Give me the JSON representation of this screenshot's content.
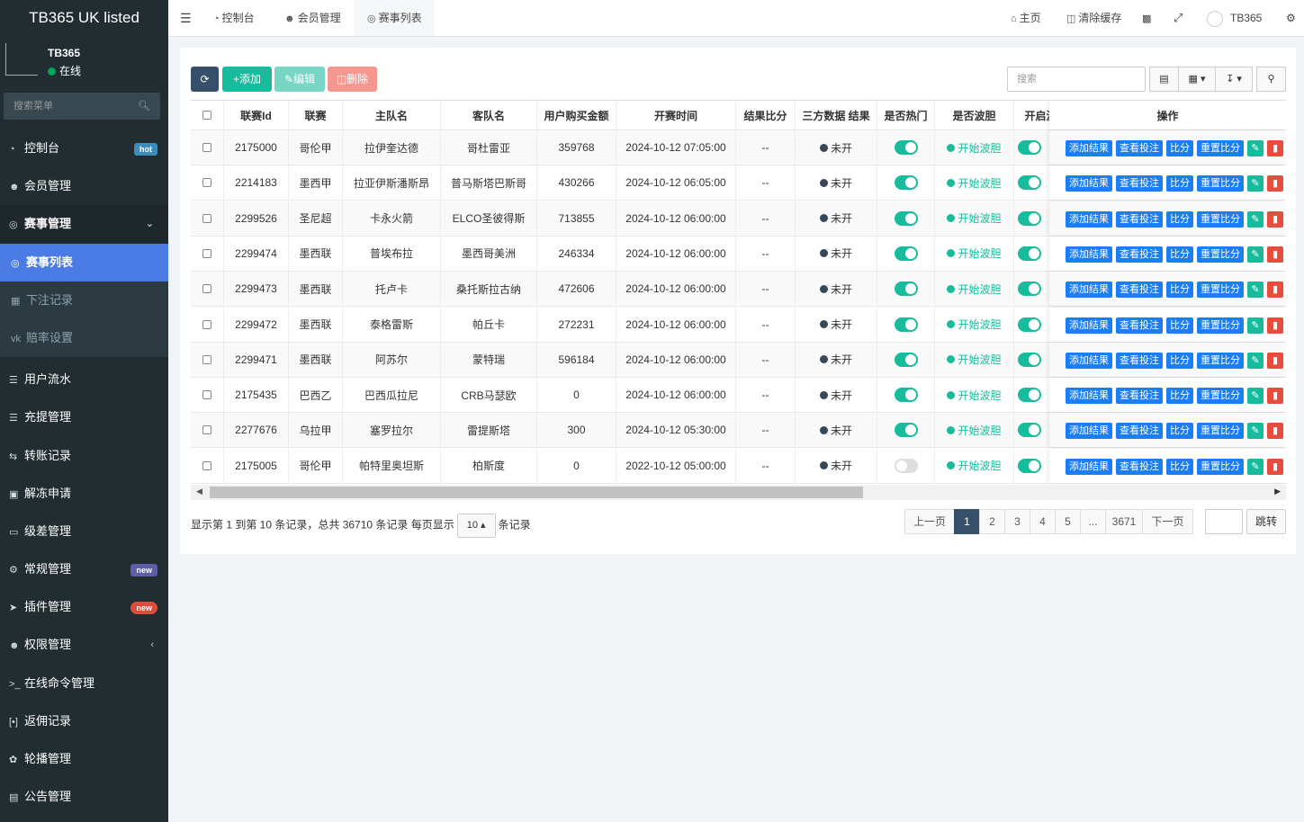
{
  "brand": {
    "title": "TB365 UK listed"
  },
  "user": {
    "name": "TB365",
    "status": "在线"
  },
  "sidebar": {
    "search_placeholder": "搜索菜单",
    "items": [
      {
        "label": "控制台",
        "badge": "hot"
      },
      {
        "label": "会员管理"
      },
      {
        "label": "赛事管理"
      },
      {
        "label": "赛事列表"
      },
      {
        "label": "下注记录"
      },
      {
        "label": "赔率设置"
      },
      {
        "label": "用户流水"
      },
      {
        "label": "充提管理"
      },
      {
        "label": "转账记录"
      },
      {
        "label": "解冻申请"
      },
      {
        "label": "级差管理"
      },
      {
        "label": "常规管理",
        "badge": "new"
      },
      {
        "label": "插件管理",
        "badge": "new"
      },
      {
        "label": "权限管理"
      },
      {
        "label": "在线命令管理"
      },
      {
        "label": "返佣记录"
      },
      {
        "label": "轮播管理"
      },
      {
        "label": "公告管理"
      }
    ]
  },
  "topbar": {
    "tabs": [
      "控制台",
      "会员管理",
      "赛事列表"
    ],
    "home": "主页",
    "clear_cache": "清除缓存",
    "username": "TB365"
  },
  "toolbar": {
    "add": "添加",
    "edit": "编辑",
    "delete": "删除",
    "search_placeholder": "搜索"
  },
  "table": {
    "headers": [
      "联赛Id",
      "联赛",
      "主队名",
      "客队名",
      "用户购买金额",
      "开赛时间",
      "结果比分",
      "三方数据 结果",
      "是否热门",
      "是否波胆",
      "开启波",
      "操作"
    ],
    "rows": [
      {
        "id": "2175000",
        "league": "哥伦甲",
        "home": "拉伊奎达德",
        "away": "哥杜雷亚",
        "amount": "359768",
        "time": "2024-10-12 07:05:00",
        "score": "--",
        "third": "未开",
        "hot": true,
        "bd": "开始波胆"
      },
      {
        "id": "2214183",
        "league": "墨西甲",
        "home": "拉亚伊斯潘斯昂",
        "away": "普马斯塔巴斯哥",
        "amount": "430266",
        "time": "2024-10-12 06:05:00",
        "score": "--",
        "third": "未开",
        "hot": true,
        "bd": "开始波胆"
      },
      {
        "id": "2299526",
        "league": "圣尼超",
        "home": "卡永火箭",
        "away": "ELCO圣彼得斯",
        "amount": "713855",
        "time": "2024-10-12 06:00:00",
        "score": "--",
        "third": "未开",
        "hot": true,
        "bd": "开始波胆"
      },
      {
        "id": "2299474",
        "league": "墨西联",
        "home": "普埃布拉",
        "away": "墨西哥美洲",
        "amount": "246334",
        "time": "2024-10-12 06:00:00",
        "score": "--",
        "third": "未开",
        "hot": true,
        "bd": "开始波胆"
      },
      {
        "id": "2299473",
        "league": "墨西联",
        "home": "托卢卡",
        "away": "桑托斯拉古纳",
        "amount": "472606",
        "time": "2024-10-12 06:00:00",
        "score": "--",
        "third": "未开",
        "hot": true,
        "bd": "开始波胆"
      },
      {
        "id": "2299472",
        "league": "墨西联",
        "home": "泰格雷斯",
        "away": "帕丘卡",
        "amount": "272231",
        "time": "2024-10-12 06:00:00",
        "score": "--",
        "third": "未开",
        "hot": true,
        "bd": "开始波胆"
      },
      {
        "id": "2299471",
        "league": "墨西联",
        "home": "阿苏尔",
        "away": "蒙特瑞",
        "amount": "596184",
        "time": "2024-10-12 06:00:00",
        "score": "--",
        "third": "未开",
        "hot": true,
        "bd": "开始波胆"
      },
      {
        "id": "2175435",
        "league": "巴西乙",
        "home": "巴西瓜拉尼",
        "away": "CRB马瑟欧",
        "amount": "0",
        "time": "2024-10-12 06:00:00",
        "score": "--",
        "third": "未开",
        "hot": true,
        "bd": "开始波胆"
      },
      {
        "id": "2277676",
        "league": "乌拉甲",
        "home": "塞罗拉尔",
        "away": "雷提斯塔",
        "amount": "300",
        "time": "2024-10-12 05:30:00",
        "score": "--",
        "third": "未开",
        "hot": true,
        "bd": "开始波胆"
      },
      {
        "id": "2175005",
        "league": "哥伦甲",
        "home": "帕特里奥坦斯",
        "away": "柏斯度",
        "amount": "0",
        "time": "2022-10-12 05:00:00",
        "score": "--",
        "third": "未开",
        "hot": false,
        "bd": "开始波胆"
      }
    ],
    "ops": {
      "add_result": "添加结果",
      "view_bets": "查看投注",
      "score": "比分",
      "reset_score": "重置比分"
    }
  },
  "pagination": {
    "info_prefix": "显示第 1 到第 10 条记录，总共 36710 条记录 每页显示",
    "page_size": "10",
    "info_suffix": "条记录",
    "prev": "上一页",
    "pages": [
      "1",
      "2",
      "3",
      "4",
      "5",
      "...",
      "3671"
    ],
    "next": "下一页",
    "jump": "跳转"
  }
}
